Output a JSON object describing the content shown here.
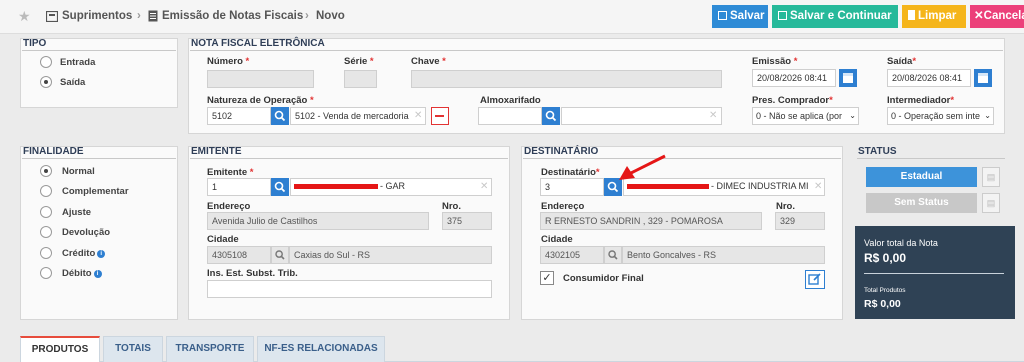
{
  "breadcrumb": {
    "items": [
      "Suprimentos",
      "Emissão de Notas Fiscais",
      "Novo"
    ]
  },
  "toolbar": {
    "salvar": "Salvar",
    "salvar_continuar": "Salvar e Continuar",
    "limpar": "Limpar",
    "cancelar": "Cancela",
    "colors": {
      "salvar": "#2e8bd6",
      "salvar_continuar": "#26b99a",
      "limpar": "#f5b51b",
      "cancelar": "#ec407a"
    }
  },
  "tipo": {
    "title": "TIPO",
    "options": [
      {
        "label": "Entrada",
        "selected": false
      },
      {
        "label": "Saída",
        "selected": true
      }
    ]
  },
  "nfe": {
    "title": "NOTA FISCAL ELETRÔNICA",
    "numero_label": "Número",
    "serie_label": "Série",
    "chave_label": "Chave",
    "emissao_label": "Emissão",
    "emissao_value": "20/08/2026 08:41",
    "saida_label": "Saída",
    "saida_value": "20/08/2026 08:41",
    "natureza_label": "Natureza de Operação",
    "natureza_code": "5102",
    "natureza_desc": "5102 - Venda de mercadoria",
    "almoxarifado_label": "Almoxarifado",
    "pres_comprador_label": "Pres. Comprador",
    "pres_comprador_value": "0 - Não se aplica (por",
    "intermediador_label": "Intermediador",
    "intermediador_value": "0 - Operação sem inte"
  },
  "finalidade": {
    "title": "FINALIDADE",
    "options": [
      {
        "label": "Normal",
        "selected": true
      },
      {
        "label": "Complementar",
        "selected": false
      },
      {
        "label": "Ajuste",
        "selected": false
      },
      {
        "label": "Devolução",
        "selected": false
      },
      {
        "label": "Crédito",
        "selected": false
      },
      {
        "label": "Débito",
        "selected": false
      }
    ]
  },
  "emitente": {
    "title": "EMITENTE",
    "emitente_label": "Emitente",
    "emitente_code": "1",
    "emitente_suffix": "- GAR",
    "endereco_label": "Endereço",
    "endereco_value": "Avenida Julio de Castilhos",
    "nro_label": "Nro.",
    "nro_value": "375",
    "cidade_label": "Cidade",
    "cidade_code": "4305108",
    "cidade_value": "Caxias do Sul - RS",
    "ie_st_label": "Ins. Est. Subst. Trib."
  },
  "destinatario": {
    "title": "DESTINATÁRIO",
    "destinatario_label": "Destinatário",
    "destinatario_code": "3",
    "destinatario_suffix": "- DIMEC INDUSTRIA MI",
    "endereco_label": "Endereço",
    "endereco_value": "R ERNESTO SANDRIN , 329 - POMAROSA",
    "nro_label": "Nro.",
    "nro_value": "329",
    "cidade_label": "Cidade",
    "cidade_code": "4302105",
    "cidade_value": "Bento Goncalves - RS",
    "consumidor_final_label": "Consumidor Final",
    "consumidor_final_checked": true
  },
  "status": {
    "title": "STATUS",
    "estadual": "Estadual",
    "sem_status": "Sem Status",
    "total_nota_label": "Valor total da Nota",
    "total_nota_value": "R$ 0,00",
    "total_produtos_label": "Total Produtos",
    "total_produtos_value": "R$ 0,00"
  },
  "tabs": [
    "PRODUTOS",
    "TOTAIS",
    "TRANSPORTE",
    "NF-ES RELACIONADAS"
  ]
}
